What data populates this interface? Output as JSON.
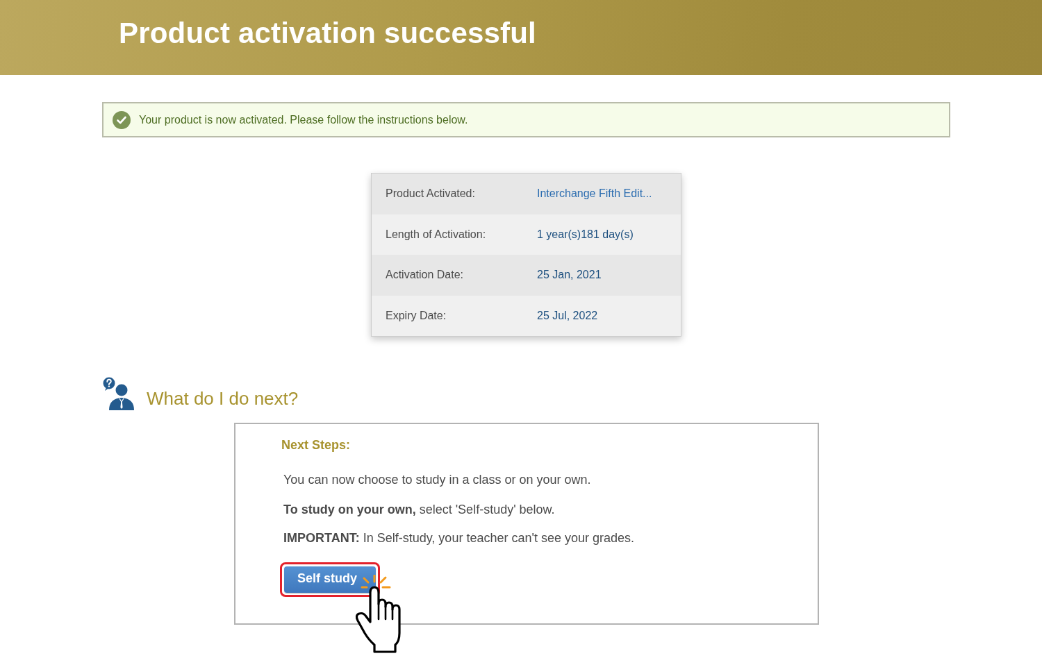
{
  "header": {
    "title": "Product activation successful"
  },
  "alert": {
    "kind": "success",
    "message": "Your product is now activated. Please follow the instructions below."
  },
  "details": [
    {
      "label": "Product Activated:",
      "value": "Interchange Fifth Edit...",
      "kind": "link"
    },
    {
      "label": "Length of Activation:",
      "value": "1 year(s)181 day(s)",
      "kind": "text"
    },
    {
      "label": "Activation Date:",
      "value": "25 Jan, 2021",
      "kind": "text"
    },
    {
      "label": "Expiry Date:",
      "value": "25 Jul, 2022",
      "kind": "text"
    }
  ],
  "next_section": {
    "title": "What do I do next?",
    "box": {
      "heading": "Next Steps:",
      "paragraphs": [
        "You can now choose to study in a class or on your own.",
        "**To study on your own,** select 'Self-study' below.",
        "**IMPORTANT:** In Self-study, your teacher can't see your grades."
      ],
      "button": {
        "label": "Self study",
        "highlighted": true
      }
    }
  }
}
